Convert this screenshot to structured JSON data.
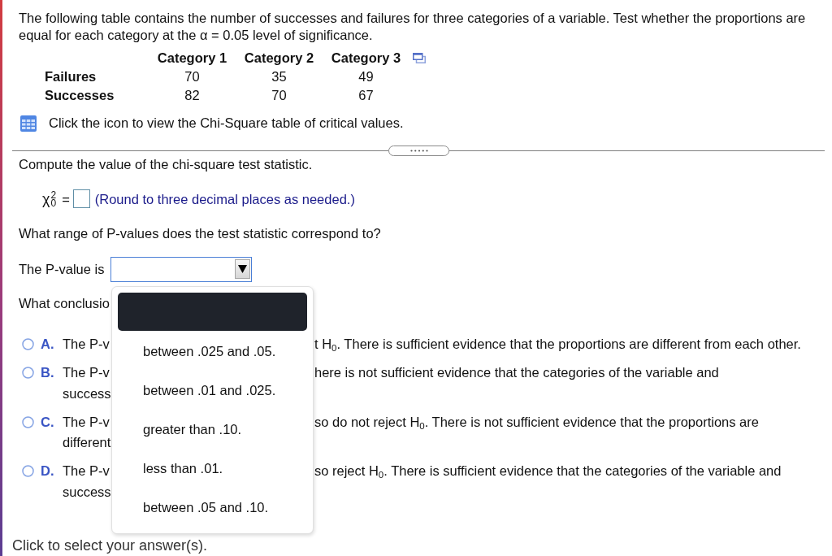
{
  "intro": "The following table contains the number of successes and failures for three categories of a variable. Test whether the proportions are equal for each category at the α = 0.05 level of significance.",
  "table": {
    "columns": [
      "Category 1",
      "Category 2",
      "Category 3"
    ],
    "rows": [
      {
        "label": "Failures",
        "values": [
          "70",
          "35",
          "49"
        ]
      },
      {
        "label": "Successes",
        "values": [
          "82",
          "70",
          "67"
        ]
      }
    ]
  },
  "table_note": "Click the icon to view the Chi-Square table of critical values.",
  "question_1": "Compute the value of the chi-square test statistic.",
  "statistic": {
    "symbol": "χ",
    "superscript": "2",
    "subscript": "0",
    "equals": "=",
    "hint": "(Round to three decimal places as needed.)"
  },
  "question_2": "What range of P-values does the test statistic correspond to?",
  "p_value": {
    "label": "The P-value is",
    "expanded": true,
    "menu": {
      "blank_option_highlighted": true,
      "options": [
        {
          "label": "between .025 and .05.",
          "selected": false
        },
        {
          "label": "between .01 and .025.",
          "selected": false
        },
        {
          "label": "greater than .10.",
          "selected": false
        },
        {
          "label": "less than .01.",
          "selected": false
        },
        {
          "label": "between .05 and .10.",
          "selected": false
        }
      ]
    }
  },
  "question_3": "What conclusio",
  "choices": [
    {
      "letter": "A.",
      "selected": false,
      "left_lines": [
        "The P-v"
      ],
      "right_text": "t H$_{0}$. There is sufficient evidence that the proportions are different from each other."
    },
    {
      "letter": "B.",
      "selected": false,
      "left_lines": [
        "The P-v",
        "success"
      ],
      "right_text": "here is not sufficient evidence that the categories of the variable and"
    },
    {
      "letter": "C.",
      "selected": false,
      "left_lines": [
        "The P-v",
        "different"
      ],
      "right_text": "so do not reject H$_{0}$. There is not sufficient evidence that the proportions are"
    },
    {
      "letter": "D.",
      "selected": false,
      "left_lines": [
        "The P-v",
        "success"
      ],
      "right_text": "so reject H$_{0}$. There is sufficient evidence that the categories of the variable and"
    }
  ],
  "footer": "Click to select your answer(s)."
}
